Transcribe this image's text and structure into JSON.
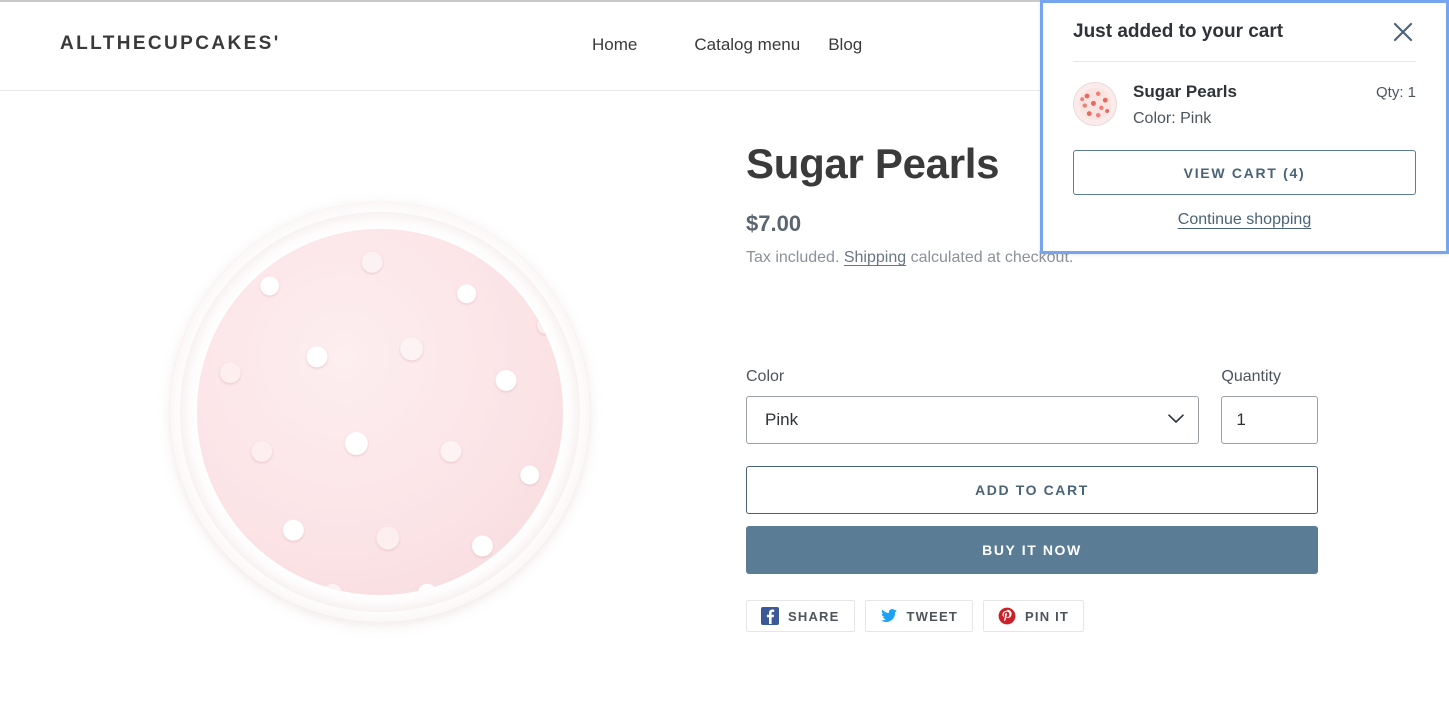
{
  "header": {
    "brand": "ALLTHECUPCAKES'",
    "nav": [
      {
        "label": "Home"
      },
      {
        "label": "Catalog menu"
      },
      {
        "label": "Blog"
      }
    ]
  },
  "product": {
    "title": "Sugar Pearls",
    "price": "$7.00",
    "tax_note_before": "Tax included. ",
    "shipping_link": "Shipping",
    "tax_note_after": " calculated at checkout.",
    "image_alt": "sugar-pearls-jar"
  },
  "form": {
    "color_label": "Color",
    "color_value": "Pink",
    "color_options": [
      "Pink"
    ],
    "quantity_label": "Quantity",
    "quantity_value": "1",
    "add_to_cart_label": "ADD TO CART",
    "buy_now_label": "BUY IT NOW"
  },
  "share": [
    {
      "label": "SHARE",
      "icon": "facebook-icon",
      "color": "#3b5998"
    },
    {
      "label": "TWEET",
      "icon": "twitter-icon",
      "color": "#1da1f2"
    },
    {
      "label": "PIN IT",
      "icon": "pinterest-icon",
      "color": "#cb2027"
    }
  ],
  "cart_popup": {
    "title": "Just added to your cart",
    "close_icon": "close-icon",
    "item": {
      "title": "Sugar Pearls",
      "variant": "Color: Pink",
      "qty": "Qty: 1",
      "thumb_alt": "sugar-pearls-thumbnail"
    },
    "view_cart_label": "VIEW CART (4)",
    "continue_label": "Continue shopping"
  },
  "colors": {
    "accent": "#5a7c95",
    "link": "#4a6377",
    "text": "#3a3a3a",
    "muted": "#8b9299",
    "focus_ring": "#76a5f0"
  }
}
